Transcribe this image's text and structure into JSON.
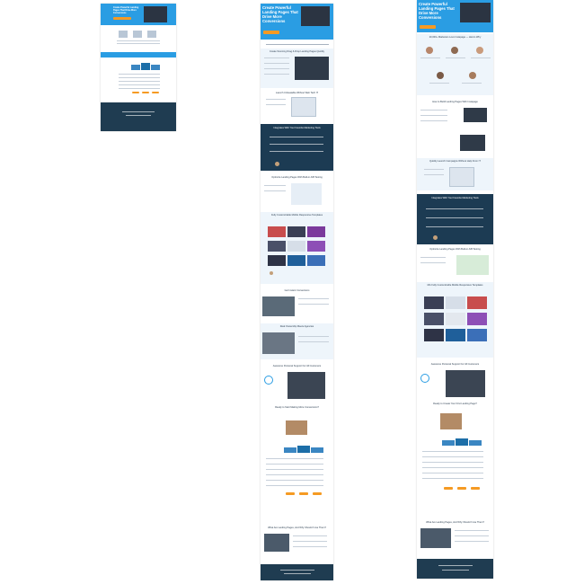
{
  "colors": {
    "hero_blue": "#2a9de3",
    "dark_navy": "#1c3b53",
    "light_blue_bg": "#eef5fb",
    "accent_orange": "#f59a23",
    "table_blue": "#3a86c2",
    "check_green": "#6cc04a",
    "footer": "#1f3c51"
  },
  "thumb_small": {
    "hero_title": "Create Powerful Landing Pages That Drive More Conversions"
  },
  "thumb_mid": {
    "hero_title": "Create Powerful Landing Pages That Drive More Conversions",
    "sections": [
      "Create Stunning Drag & Drop Landing Pages Quickly",
      "Launch Unbeatable Without Web Tech IT",
      "Integrates With Your Favorite Marketing Tools",
      "Optimize Landing Pages With Built-in A/B Testing",
      "Fully Customizable Mobile Responsive Templates",
      "Get Instant Conversions",
      "Real Ownership Meets Agencies",
      "Awesome Personal Support For All Customers",
      "Ready to Start Making More Conversions?",
      "What Are Landing Pages, And Why Should I Use Them?"
    ]
  },
  "thumb_right": {
    "hero_title": "Create Powerful Landing Pages That Drive More Conversions",
    "sections": [
      "20,000+ Marketers Love Instapage — Here's Why",
      "How to Build Landing Pages With Instapage",
      "Quickly Launch Campaigns Without Help From IT",
      "Integrates With Your Favorite Marketing Tools",
      "Optimize Landing Pages With Built-in A/B Testing",
      "Mix Fully Customizable Mobile Responsive Templates",
      "Awesome Personal Support For All Customers",
      "Ready to Create Your First Landing Page?",
      "What Are Landing Pages, And Why Should I Use Them?"
    ]
  },
  "icons": {
    "hero_screen": "laptop-screen-icon",
    "check": "check-icon",
    "play": "play-icon",
    "avatar": "avatar-icon"
  }
}
